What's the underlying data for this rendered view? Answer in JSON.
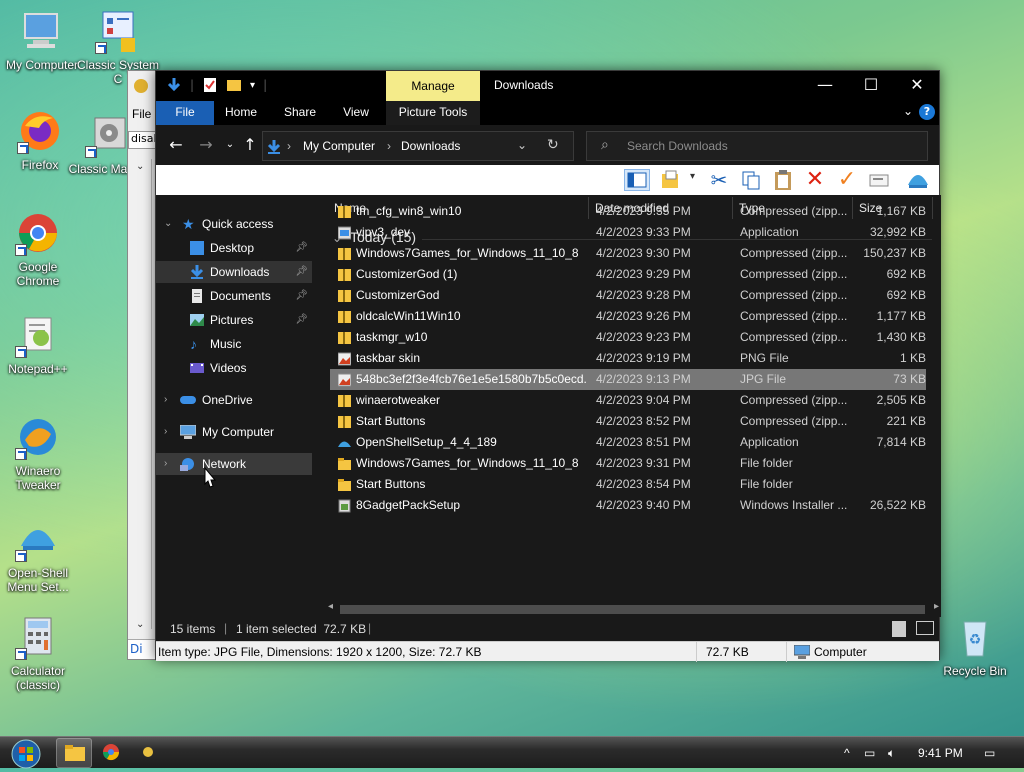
{
  "desktop": {
    "icons": [
      {
        "label": "My Computer"
      },
      {
        "label": "Classic System C"
      },
      {
        "label": "Firefox"
      },
      {
        "label": "Classic Manag"
      },
      {
        "label": "Google Chrome"
      },
      {
        "label": "Notepad++"
      },
      {
        "label": "Winaero Tweaker"
      },
      {
        "label": "Open-Shell Menu Set..."
      },
      {
        "label": "Calculator (classic)"
      },
      {
        "label": "Recycle Bin"
      }
    ]
  },
  "bg_window": {
    "menu_file": "File",
    "input_value": "disab",
    "bottom_text": "Di"
  },
  "window": {
    "title": "Downloads",
    "context_tab": "Manage",
    "context_subtab": "Picture Tools",
    "tabs": [
      "File",
      "Home",
      "Share",
      "View"
    ],
    "controls": {
      "minimize": "—",
      "maximize": "☐",
      "close": "✕"
    },
    "help": "?"
  },
  "address": {
    "crumbs": [
      "My Computer",
      "Downloads"
    ],
    "separator": "›",
    "search_placeholder": "Search Downloads"
  },
  "nav": {
    "items": [
      {
        "label": "Quick access"
      },
      {
        "label": "Desktop"
      },
      {
        "label": "Downloads"
      },
      {
        "label": "Documents"
      },
      {
        "label": "Pictures"
      },
      {
        "label": "Music"
      },
      {
        "label": "Videos"
      },
      {
        "label": "OneDrive"
      },
      {
        "label": "My Computer"
      },
      {
        "label": "Network"
      }
    ]
  },
  "columns": {
    "name": "Name",
    "date": "Date modified",
    "type": "Type",
    "size": "Size"
  },
  "group_label": "Today (15)",
  "files": [
    {
      "name": "tm_cfg_win8_win10",
      "date": "4/2/2023 9:35 PM",
      "type": "Compressed (zipp...",
      "size": "1,167 KB",
      "icon": "zip"
    },
    {
      "name": "vipv3_dev",
      "date": "4/2/2023 9:33 PM",
      "type": "Application",
      "size": "32,992 KB",
      "icon": "app"
    },
    {
      "name": "Windows7Games_for_Windows_11_10_8",
      "date": "4/2/2023 9:30 PM",
      "type": "Compressed (zipp...",
      "size": "150,237 KB",
      "icon": "zip"
    },
    {
      "name": "CustomizerGod (1)",
      "date": "4/2/2023 9:29 PM",
      "type": "Compressed (zipp...",
      "size": "692 KB",
      "icon": "zip"
    },
    {
      "name": "CustomizerGod",
      "date": "4/2/2023 9:28 PM",
      "type": "Compressed (zipp...",
      "size": "692 KB",
      "icon": "zip"
    },
    {
      "name": "oldcalcWin11Win10",
      "date": "4/2/2023 9:26 PM",
      "type": "Compressed (zipp...",
      "size": "1,177 KB",
      "icon": "zip"
    },
    {
      "name": "taskmgr_w10",
      "date": "4/2/2023 9:23 PM",
      "type": "Compressed (zipp...",
      "size": "1,430 KB",
      "icon": "zip"
    },
    {
      "name": "taskbar skin",
      "date": "4/2/2023 9:19 PM",
      "type": "PNG File",
      "size": "1 KB",
      "icon": "img"
    },
    {
      "name": "548bc3ef2f3e4fcb76e1e5e1580b7b5c0ecd...",
      "date": "4/2/2023 9:13 PM",
      "type": "JPG File",
      "size": "73 KB",
      "icon": "img"
    },
    {
      "name": "winaerotweaker",
      "date": "4/2/2023 9:04 PM",
      "type": "Compressed (zipp...",
      "size": "2,505 KB",
      "icon": "zip"
    },
    {
      "name": "Start Buttons",
      "date": "4/2/2023 8:52 PM",
      "type": "Compressed (zipp...",
      "size": "221 KB",
      "icon": "zip"
    },
    {
      "name": "OpenShellSetup_4_4_189",
      "date": "4/2/2023 8:51 PM",
      "type": "Application",
      "size": "7,814 KB",
      "icon": "shell"
    },
    {
      "name": "Windows7Games_for_Windows_11_10_8",
      "date": "4/2/2023 9:31 PM",
      "type": "File folder",
      "size": "",
      "icon": "folder"
    },
    {
      "name": "Start Buttons",
      "date": "4/2/2023 8:54 PM",
      "type": "File folder",
      "size": "",
      "icon": "folder"
    },
    {
      "name": "8GadgetPackSetup",
      "date": "4/2/2023 9:40 PM",
      "type": "Windows Installer ...",
      "size": "26,522 KB",
      "icon": "msi"
    }
  ],
  "status": {
    "count": "15 items",
    "selected": "1 item selected  72.7 KB"
  },
  "details": {
    "info": "Item type: JPG File, Dimensions: 1920 x 1200, Size: 72.7 KB",
    "size": "72.7 KB",
    "location": "Computer"
  },
  "taskbar": {
    "time": "9:41 PM"
  }
}
